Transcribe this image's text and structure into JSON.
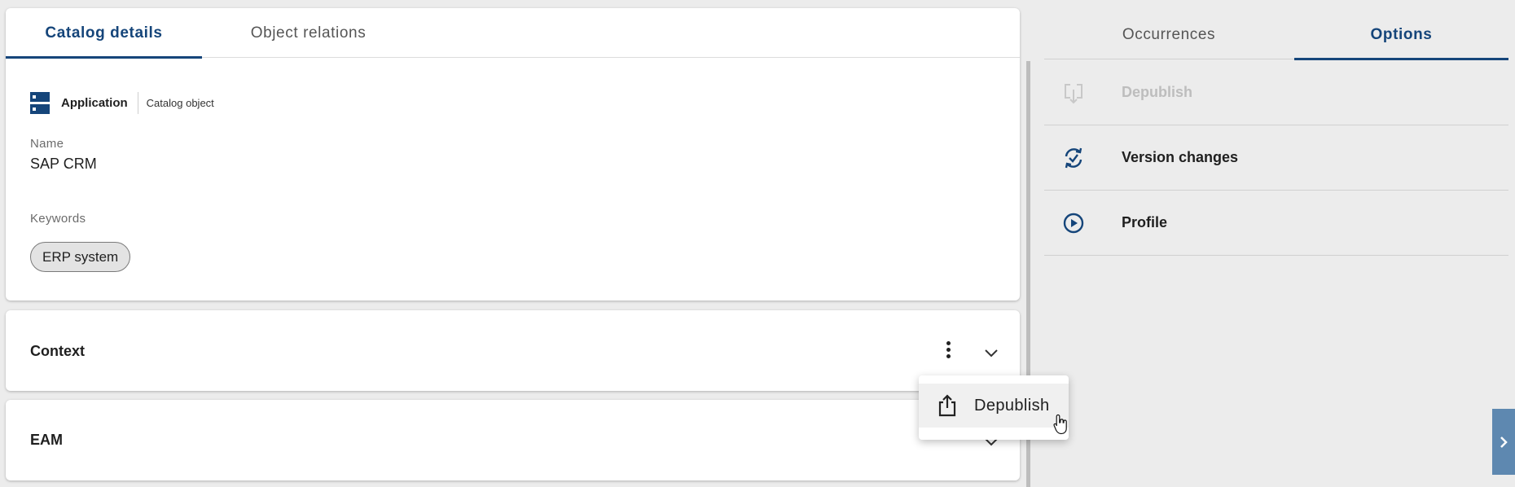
{
  "left_tabs": [
    {
      "label": "Catalog details",
      "active": true
    },
    {
      "label": "Object relations",
      "active": false
    }
  ],
  "object": {
    "type_icon": "application-icon",
    "type_label": "Application",
    "type_sub": "Catalog object"
  },
  "fields": {
    "name_label": "Name",
    "name_value": "SAP CRM",
    "keywords_label": "Keywords",
    "keywords": [
      "ERP system"
    ]
  },
  "sections": [
    {
      "title": "Context"
    },
    {
      "title": "EAM"
    }
  ],
  "menu": {
    "items": [
      {
        "label": "Depublish",
        "icon": "share-upload-icon"
      }
    ]
  },
  "right_tabs": [
    {
      "label": "Occurrences",
      "active": false
    },
    {
      "label": "Options",
      "active": true
    }
  ],
  "options": [
    {
      "label": "Depublish",
      "icon": "depublish-icon",
      "disabled": true
    },
    {
      "label": "Version changes",
      "icon": "version-changes-icon",
      "disabled": false
    },
    {
      "label": "Profile",
      "icon": "profile-play-icon",
      "disabled": false
    }
  ],
  "colors": {
    "accent": "#15457a",
    "background": "#ececec",
    "disabled_text": "#bdbdbd",
    "side_toggle": "#5e88b0"
  }
}
